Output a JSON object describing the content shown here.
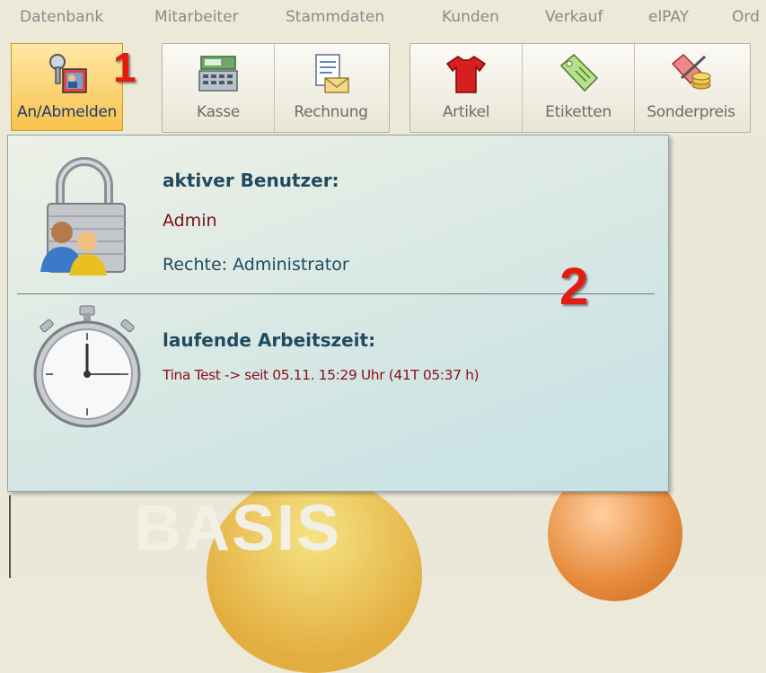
{
  "menu": {
    "items": [
      "Datenbank",
      "Mitarbeiter",
      "Stammdaten",
      "Kunden",
      "Verkauf",
      "elPAY",
      "Ord"
    ]
  },
  "toolbar": {
    "groups": [
      {
        "buttons": [
          {
            "label": "An/Abmelden",
            "icon": "login-user-icon",
            "active": true
          }
        ]
      },
      {
        "buttons": [
          {
            "label": "Kasse",
            "icon": "cash-register-icon"
          },
          {
            "label": "Rechnung",
            "icon": "invoice-icon"
          }
        ]
      },
      {
        "buttons": [
          {
            "label": "Artikel",
            "icon": "shirt-icon"
          },
          {
            "label": "Etiketten",
            "icon": "tag-icon"
          },
          {
            "label": "Sonderpreis",
            "icon": "special-price-icon"
          }
        ]
      }
    ]
  },
  "annotations": {
    "one": "1",
    "two": "2"
  },
  "popup": {
    "user_section": {
      "title": "aktiver Benutzer:",
      "user": "Admin",
      "rights": "Rechte: Administrator"
    },
    "work_section": {
      "title": "laufende Arbeitszeit:",
      "entry": "Tina Test -> seit 05.11. 15:29 Uhr (41T 05:37 h)"
    }
  },
  "background": {
    "logo_text": "BASIS"
  },
  "colors": {
    "accent_red": "#e41b13",
    "active_button": "#f8c24c",
    "popup_bg": "#d4e6e4"
  }
}
